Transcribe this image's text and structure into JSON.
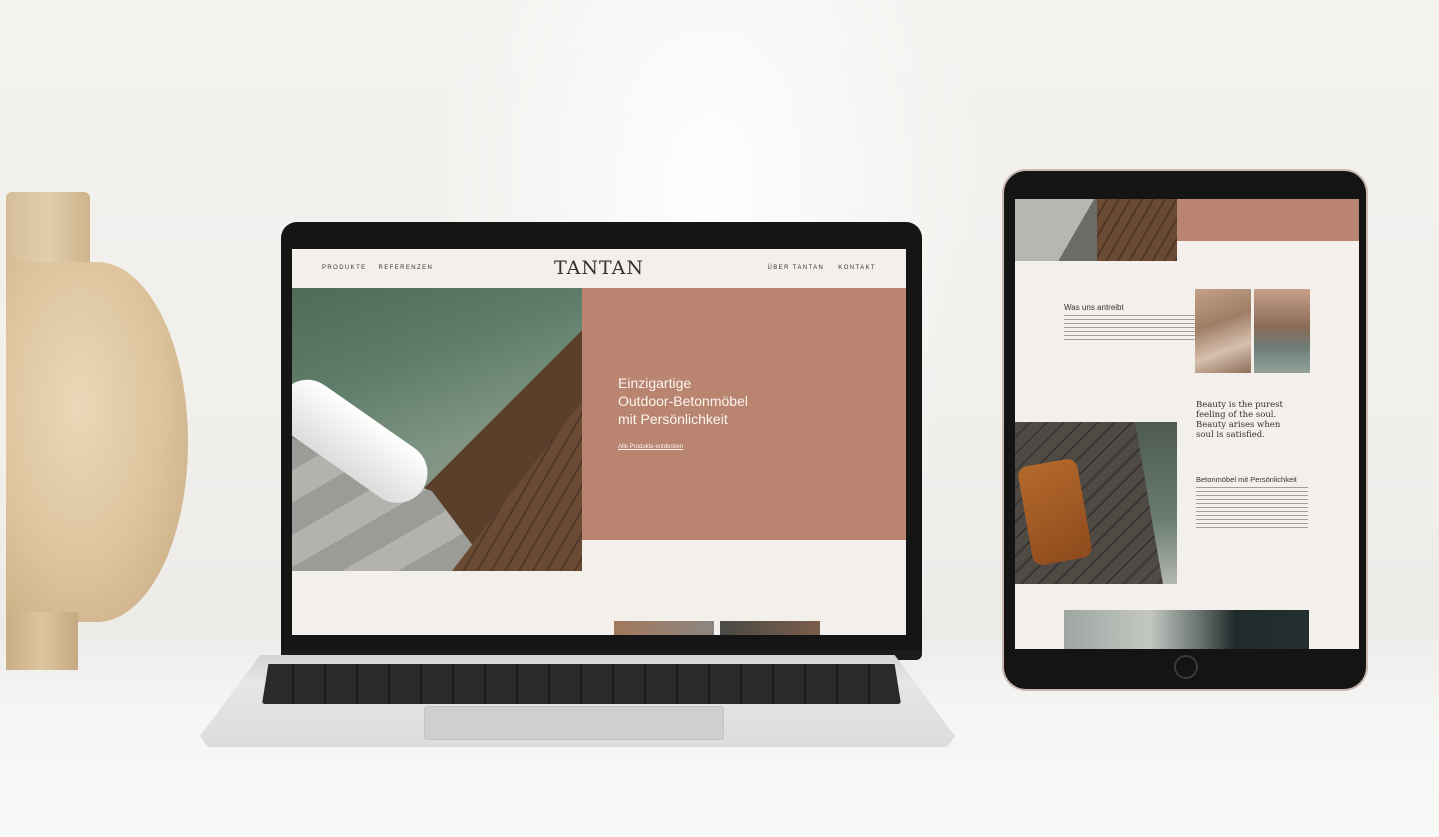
{
  "laptop_site": {
    "nav_left": [
      "PRODUKTE",
      "REFERENZEN"
    ],
    "logo": "TANTAN",
    "nav_right": [
      "ÜBER TANTAN",
      "KONTAKT"
    ],
    "hero": {
      "title_lines": [
        "Einzigartige",
        "Outdoor-Betonmöbel",
        "mit Persönlichkeit"
      ],
      "link": "Alle Produkte entdecken"
    }
  },
  "tablet_site": {
    "section1_heading": "Was uns antreibt",
    "quote_lines": [
      "Beauty is the purest",
      "feeling of the soul.",
      "Beauty arises when",
      "soul is satisfied."
    ],
    "quote_author": "",
    "section2_heading": "Betonmöbel mit Persönlichkeit"
  },
  "colors": {
    "terracotta": "#b98570",
    "page_bg": "#f3efea",
    "text_dark": "#3b342f"
  }
}
